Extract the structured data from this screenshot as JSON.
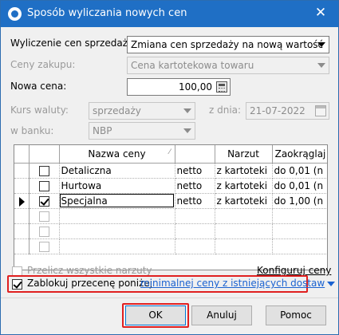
{
  "window": {
    "title": "Sposób wyliczania nowych cen",
    "close_glyph": "✕"
  },
  "form": {
    "calc_label": "Wyliczenie cen sprzedaży:",
    "calc_value": "Zmiana cen sprzedaży na nową wartość",
    "purchase_label": "Ceny zakupu:",
    "purchase_value": "Cena kartotekowa towaru",
    "new_price_label": "Nowa cena:",
    "new_price_value": "100,00",
    "rate_label": "Kurs waluty:",
    "rate_value": "sprzedaży",
    "date_label": "z dnia:",
    "date_value": "21-07-2022",
    "bank_label": "w banku:",
    "bank_value": "NBP"
  },
  "grid": {
    "columns": [
      "",
      "",
      "Nazwa ceny",
      "",
      "Narzut",
      "Zaokrąglaj"
    ],
    "rows": [
      {
        "checked": false,
        "name": "Detaliczna",
        "type": "netto",
        "markup": "z kartoteki",
        "rounding": "do 0,01 (n",
        "current": false
      },
      {
        "checked": false,
        "name": "Hurtowa",
        "type": "netto",
        "markup": "z kartoteki",
        "rounding": "do 0,01 (n",
        "current": false
      },
      {
        "checked": true,
        "name": "Specjalna",
        "type": "netto",
        "markup": "z kartoteki",
        "rounding": "do 1,00 (n",
        "current": true
      },
      {
        "checked": false,
        "name": "",
        "type": "",
        "markup": "",
        "rounding": "",
        "current": false
      },
      {
        "checked": false,
        "name": "",
        "type": "",
        "markup": "",
        "rounding": "",
        "current": false
      },
      {
        "checked": false,
        "name": "",
        "type": "",
        "markup": "",
        "rounding": "",
        "current": false
      }
    ]
  },
  "options": {
    "recalc_label": "Przelicz wszystkie narzuty",
    "config_link": "Konfiguruj ceny",
    "block_label": "Zablokuj przecenę poniżej",
    "block_link": "minimalnej ceny z istniejących dostaw",
    "block_checked": true
  },
  "buttons": {
    "ok": "OK",
    "cancel": "Anuluj",
    "help": "Pomoc"
  },
  "colors": {
    "titlebar": "#1f6fc5",
    "highlight": "#e02020",
    "link": "#1a62d1"
  }
}
